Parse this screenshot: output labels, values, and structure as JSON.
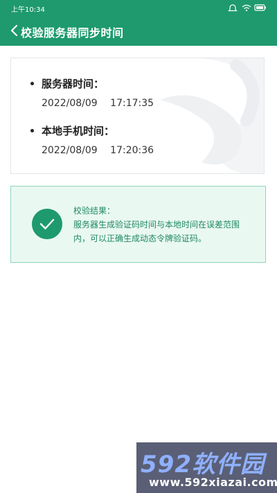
{
  "status_bar": {
    "time": "上午10:34"
  },
  "header": {
    "title": "校验服务器同步时间"
  },
  "times": {
    "server_label": "服务器时间：",
    "server_date": "2022/08/09",
    "server_time": "17:17:35",
    "phone_label": "本地手机时间：",
    "phone_date": "2022/08/09",
    "phone_time": "17:20:36"
  },
  "result": {
    "title": "校验结果：",
    "description": "服务器生成验证码时间与本地时间在误差范围内，可以正确生成动态令牌验证码。"
  },
  "watermark": {
    "logo": "592软件园",
    "url": "www.592xiazai.com"
  },
  "colors": {
    "primary": "#1e9a6e",
    "result_bg": "#eaf8f2",
    "result_border": "#8fd5b8"
  }
}
